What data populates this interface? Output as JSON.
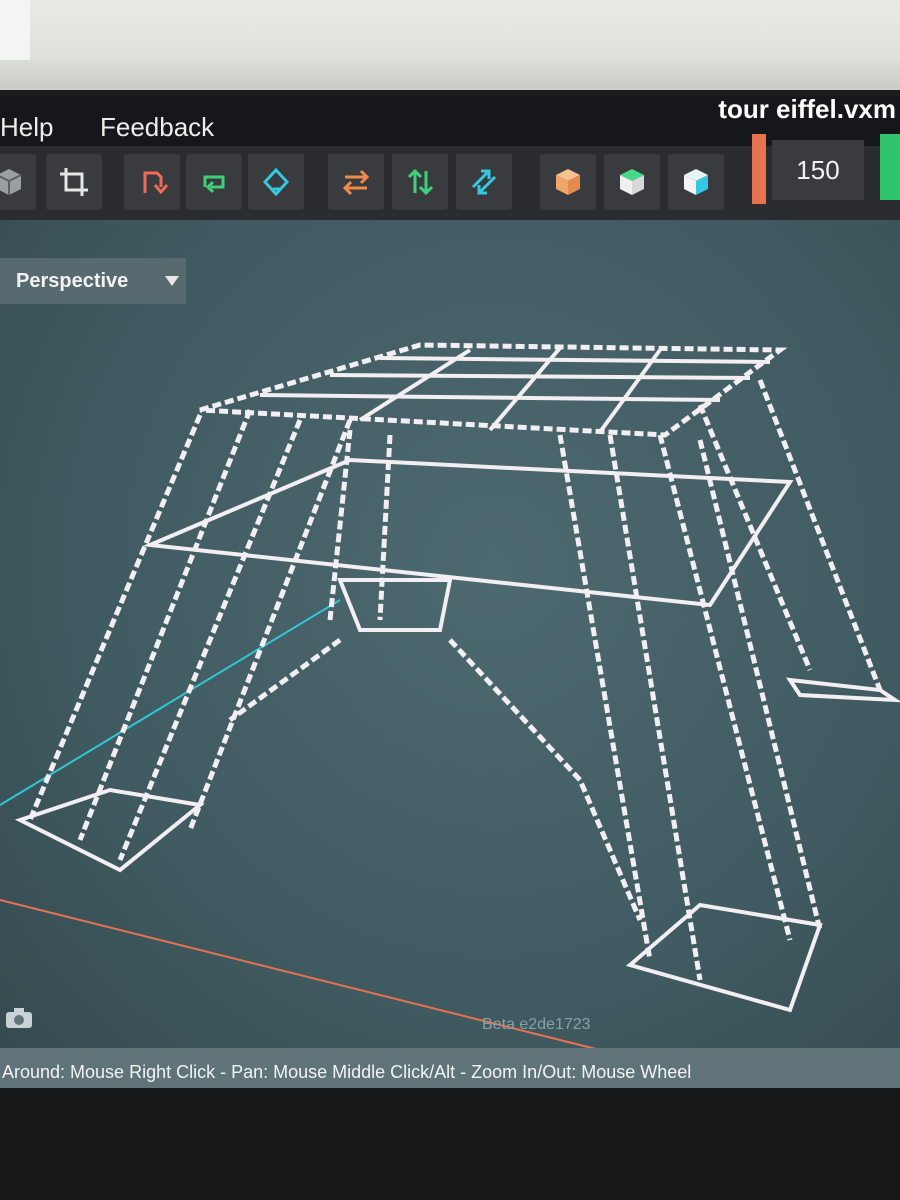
{
  "menu": {
    "help": "Help",
    "feedback": "Feedback"
  },
  "file": {
    "title": "tour eiffel.vxm"
  },
  "toolbar": {
    "value": "150"
  },
  "view": {
    "mode": "Perspective"
  },
  "version": "Beta e2de1723",
  "status": "Around: Mouse Right Click - Pan: Mouse Middle Click/Alt - Zoom In/Out: Mouse Wheel",
  "colors": {
    "viewport": "#46626a",
    "axis_x": "#e8734f",
    "axis_z": "#33c6d6",
    "voxel": "#f2eef2",
    "accent_green": "#2fc46b"
  },
  "icons": [
    "cube-view-icon",
    "crop-icon",
    "rotate-red-icon",
    "loop-green-icon",
    "rotate-cyan-icon",
    "swap-horizontal-icon",
    "swap-vertical-icon",
    "swap-diagonal-icon",
    "orange-cube-icon",
    "green-cube-icon",
    "cyan-cube-icon",
    "camera-icon",
    "dropdown-caret-icon"
  ]
}
